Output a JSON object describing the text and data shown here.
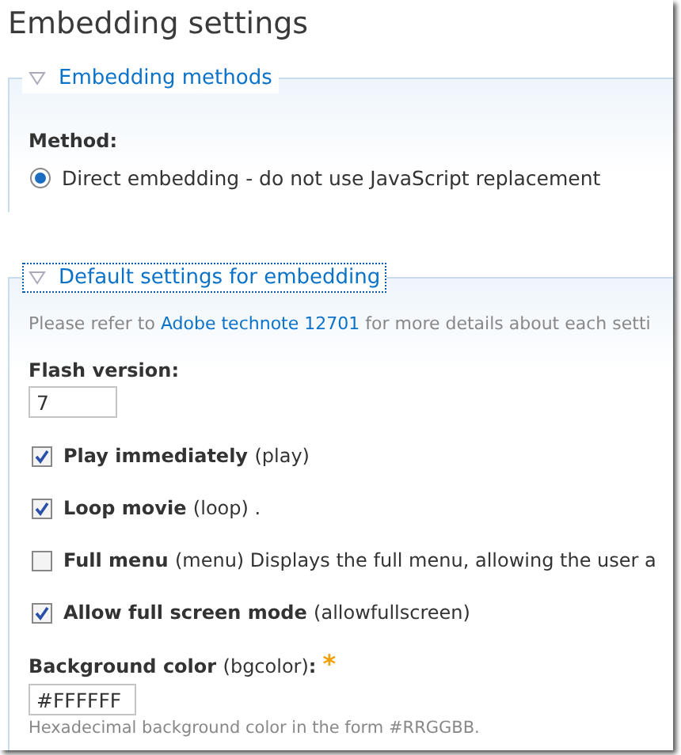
{
  "title": "Embedding settings",
  "fieldsets": [
    {
      "legend": "Embedding methods",
      "expanded": true,
      "focused": false,
      "items": [
        {
          "kind": "radios",
          "label": "Method:",
          "options": [
            {
              "label": "Direct embedding - do not use JavaScript replacement",
              "selected": true
            }
          ]
        }
      ]
    },
    {
      "legend": "Default settings for embedding",
      "expanded": true,
      "focused": true,
      "items": [
        {
          "kind": "note",
          "before": "Please refer to",
          "link": "Adobe technote 12701",
          "after": "for more details about each setti"
        },
        {
          "kind": "textfield",
          "label": "Flash version:",
          "value": "7"
        },
        {
          "kind": "checkbox",
          "label": "Play immediately",
          "note": "(play)",
          "checked": true
        },
        {
          "kind": "checkbox",
          "label": "Loop movie",
          "note": "(loop) .",
          "checked": true
        },
        {
          "kind": "checkbox",
          "label": "Full menu",
          "note": "(menu) Displays the full menu, allowing the user a",
          "checked": false
        },
        {
          "kind": "checkbox",
          "label": "Allow full screen mode",
          "note": "(allowfullscreen)",
          "checked": true
        },
        {
          "kind": "textfield",
          "label": "Background color",
          "note": "(bgcolor)",
          "suffix": ":",
          "required_mark": "*",
          "value": "#FFFFFF",
          "description": "Hexadecimal background color in the form #RRGGBB."
        }
      ]
    }
  ]
}
